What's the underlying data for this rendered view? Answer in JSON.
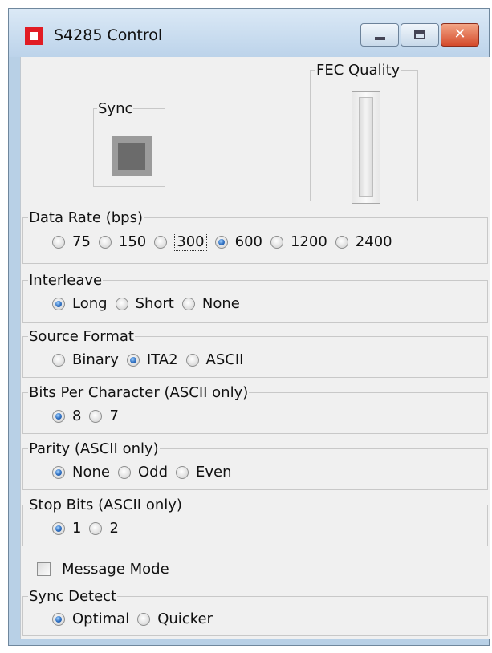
{
  "window": {
    "title": "S4285 Control",
    "close_symbol": "✕"
  },
  "sync": {
    "label": "Sync"
  },
  "fec_quality": {
    "label": "FEC Quality"
  },
  "data_rate": {
    "label": "Data Rate (bps)",
    "options": [
      "75",
      "150",
      "300",
      "600",
      "1200",
      "2400"
    ],
    "selected": "600",
    "focused": "300"
  },
  "interleave": {
    "label": "Interleave",
    "options": [
      "Long",
      "Short",
      "None"
    ],
    "selected": "Long"
  },
  "source_format": {
    "label": "Source Format",
    "options": [
      "Binary",
      "ITA2",
      "ASCII"
    ],
    "selected": "ITA2"
  },
  "bits_per_character": {
    "label": "Bits Per Character  (ASCII only)",
    "options": [
      "8",
      "7"
    ],
    "selected": "8"
  },
  "parity": {
    "label": "Parity  (ASCII only)",
    "options": [
      "None",
      "Odd",
      "Even"
    ],
    "selected": "None"
  },
  "stop_bits": {
    "label": "Stop Bits  (ASCII only)",
    "options": [
      "1",
      "2"
    ],
    "selected": "1"
  },
  "message_mode": {
    "label": "Message Mode",
    "checked": false
  },
  "sync_detect": {
    "label": "Sync Detect",
    "options": [
      "Optimal",
      "Quicker"
    ],
    "selected": "Optimal"
  }
}
